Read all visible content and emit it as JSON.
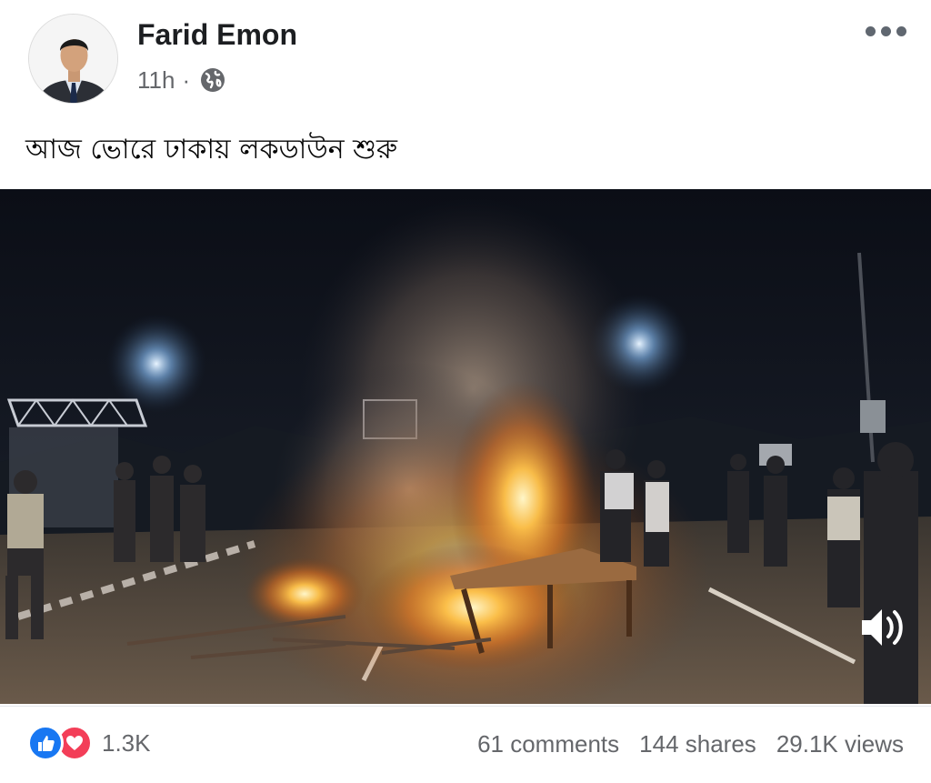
{
  "author": {
    "name": "Farid Emon",
    "time": "11h",
    "separator": "·",
    "audience_icon": "globe-icon"
  },
  "post": {
    "text": "আজ ভোরে ঢাকায় লকডাউন শুরু"
  },
  "media": {
    "type": "video",
    "volume_icon": "volume-icon"
  },
  "engagement": {
    "reaction_icons": [
      "like-icon",
      "love-icon"
    ],
    "reaction_count": "1.3K",
    "comments": "61 comments",
    "shares": "144 shares",
    "views": "29.1K views"
  },
  "colors": {
    "like": "#1877f2",
    "love": "#f33e58",
    "secondary_text": "#65676b"
  }
}
